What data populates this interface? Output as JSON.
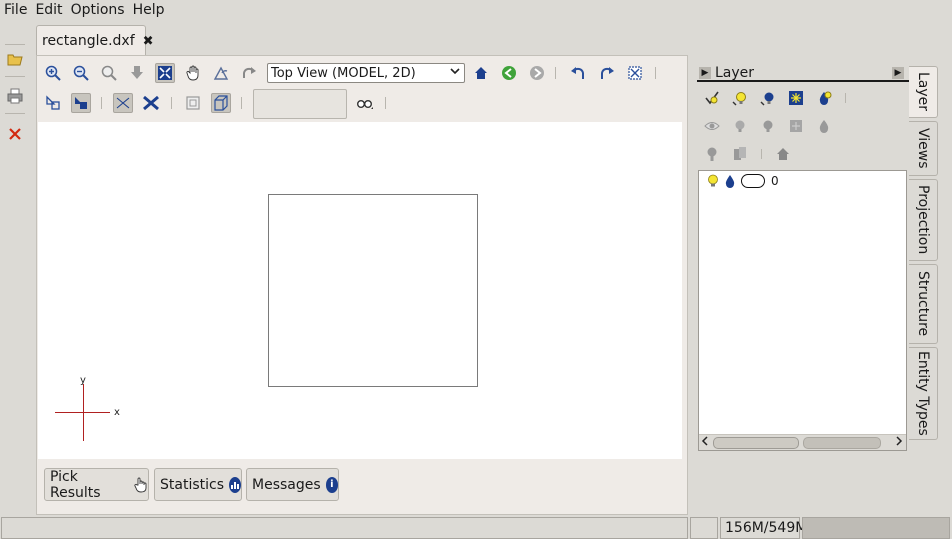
{
  "menu": {
    "file": "File",
    "edit": "Edit",
    "options": "Options",
    "help": "Help"
  },
  "document_tab": {
    "label": "rectangle.dxf",
    "close": "✖"
  },
  "toolbar": {
    "view_select": "Top View (MODEL, 2D)"
  },
  "canvas": {
    "axis_x": "x",
    "axis_y": "y"
  },
  "layer_panel": {
    "title": "Layer",
    "layers": [
      {
        "name": "0"
      }
    ]
  },
  "side_tabs": [
    {
      "label": "Layer"
    },
    {
      "label": "Views"
    },
    {
      "label": "Projection"
    },
    {
      "label": "Structure"
    },
    {
      "label": "Entity Types"
    }
  ],
  "dock": {
    "pick_results": "Pick Results",
    "statistics": "Statistics",
    "messages": "Messages"
  },
  "status": {
    "message": "",
    "memory": "156M/549M"
  },
  "colors": {
    "accent_blue": "#1c3f8e",
    "axis_red": "#b02020",
    "bulb_yellow": "#f4e533"
  }
}
